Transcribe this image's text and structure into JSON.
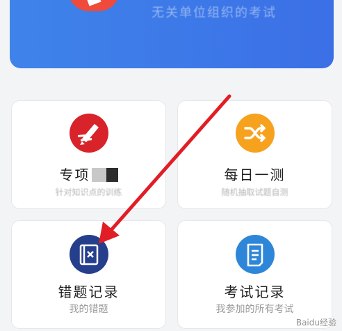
{
  "banner": {
    "text": "无关单位组织的考试"
  },
  "cards": [
    {
      "title": "专项",
      "desc": "针对知识点的训练",
      "icon": "pencil-badge-icon"
    },
    {
      "title": "每日一测",
      "desc": "随机抽取试题自测",
      "icon": "shuffle-icon"
    },
    {
      "title": "错题记录",
      "desc": "我的错题",
      "icon": "wrong-book-icon"
    },
    {
      "title": "考试记录",
      "desc": "我参加的所有考试",
      "icon": "document-list-icon"
    }
  ],
  "colors": {
    "banner_blue": "#3f83ea",
    "red": "#d8232a",
    "orange": "#f6a21e",
    "navy": "#253f8c",
    "sky": "#2e86d8",
    "arrow": "#e11d25"
  },
  "watermark": "Baidu经验"
}
